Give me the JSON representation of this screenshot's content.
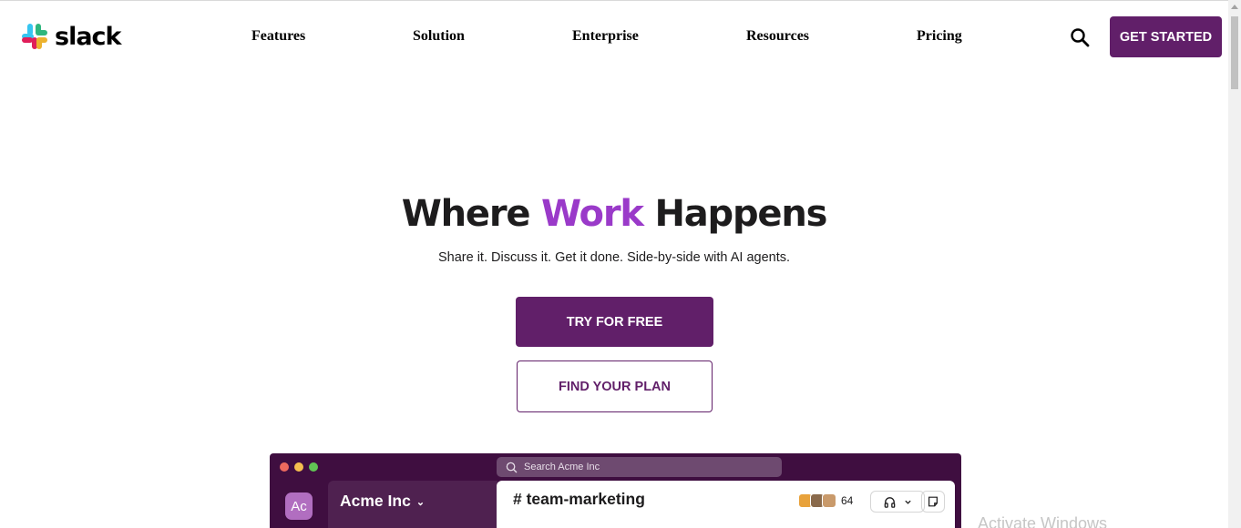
{
  "header": {
    "logo_text": "slack",
    "nav": [
      "Features",
      "Solution",
      "Enterprise",
      "Resources",
      "Pricing"
    ],
    "search_icon": "search-icon",
    "cta_label": "GET STARTED"
  },
  "hero": {
    "title_before": "Where ",
    "title_accent": "Work",
    "title_after": " Happens",
    "subtitle": "Share it. Discuss it. Get it done. Side-by-side with AI agents.",
    "primary_cta": "TRY FOR FREE",
    "secondary_cta": "FIND YOUR PLAN"
  },
  "app_preview": {
    "search_placeholder": "Search Acme Inc",
    "workspace_initials": "Ac",
    "workspace_name": "Acme Inc",
    "channel": "# team-marketing",
    "member_count": "64"
  },
  "colors": {
    "brand": "#611f69",
    "accent": "#9a3ac9",
    "app_bg": "#3f0e40"
  },
  "overlay": {
    "watermark": "Activate Windows"
  }
}
